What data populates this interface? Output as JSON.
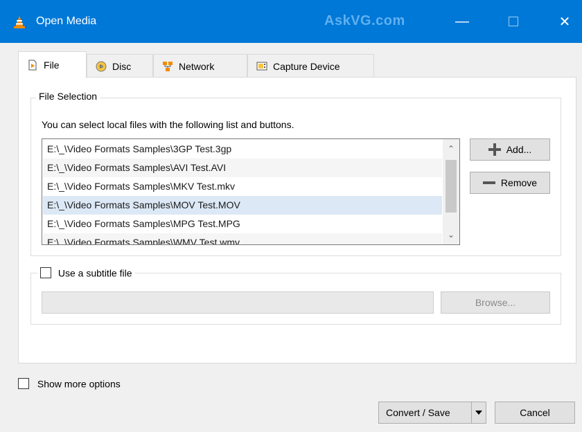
{
  "window": {
    "title": "Open Media",
    "watermark": "AskVG.com",
    "minimize": "—",
    "close": "✕"
  },
  "tabs": [
    {
      "label": "File",
      "icon": "file-icon",
      "active": true
    },
    {
      "label": "Disc",
      "icon": "disc-icon"
    },
    {
      "label": "Network",
      "icon": "network-icon"
    },
    {
      "label": "Capture Device",
      "icon": "capture-device-icon"
    }
  ],
  "file_selection": {
    "group_label": "File Selection",
    "hint": "You can select local files with the following list and buttons.",
    "files": [
      "E:\\_\\Video Formats Samples\\3GP Test.3gp",
      "E:\\_\\Video Formats Samples\\AVI Test.AVI",
      "E:\\_\\Video Formats Samples\\MKV Test.mkv",
      "E:\\_\\Video Formats Samples\\MOV Test.MOV",
      "E:\\_\\Video Formats Samples\\MPG Test.MPG",
      "E:\\_\\Video Formats Samples\\WMV Test.wmv"
    ],
    "selected_index": 3,
    "add_label": "Add...",
    "remove_label": "Remove"
  },
  "subtitle": {
    "checkbox_label": "Use a subtitle file",
    "checked": false,
    "path_value": "",
    "browse_label": "Browse..."
  },
  "footer": {
    "show_more_label": "Show more options",
    "convert_label": "Convert / Save",
    "cancel_label": "Cancel"
  },
  "colors": {
    "titlebar": "#0078d7",
    "selection": "#dce8f5",
    "vlc_cone": "#f08c00"
  }
}
